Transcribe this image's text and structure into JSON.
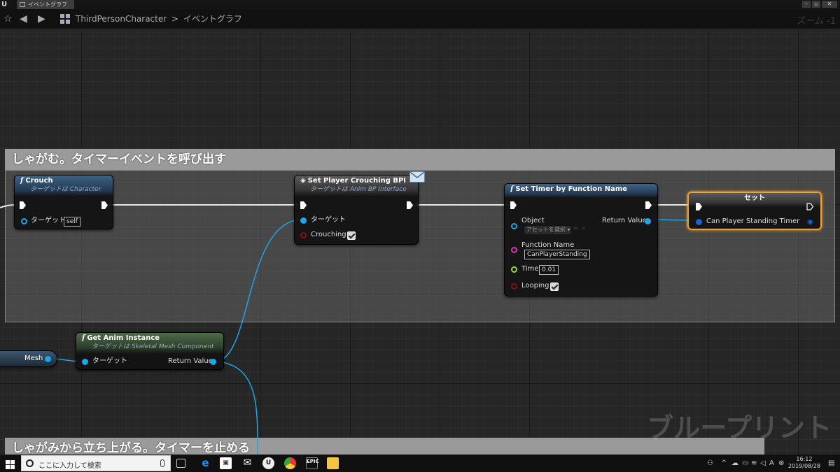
{
  "window": {
    "tab_label": "イベントグラフ"
  },
  "breadcrumb": {
    "blueprint": "ThirdPersonCharacter",
    "separator": ">",
    "graph": "イベントグラフ"
  },
  "zoom": "ズーム -1",
  "comments": {
    "top": "しゃがむ。タイマーイベントを呼び出す",
    "bottom": "しゃがみから立ち上がる。タイマーを止める"
  },
  "nodes": {
    "crouch": {
      "title": "Crouch",
      "subtitle": "ターゲットは Character",
      "target_label": "ターゲット",
      "target_value": "self"
    },
    "set_player_crouching": {
      "title": "Set Player Crouching BPI",
      "subtitle": "ターゲットは Anim BP Interface",
      "target_label": "ターゲット",
      "crouching_label": "Crouching",
      "crouching_checked": true
    },
    "set_timer": {
      "title": "Set Timer by Function Name",
      "object_label": "Object",
      "object_value": "アセットを選択",
      "return_label": "Return Value",
      "function_name_label": "Function Name",
      "function_name_value": "CanPlayerStanding",
      "time_label": "Time",
      "time_value": "0.01",
      "looping_label": "Looping",
      "looping_checked": true
    },
    "set_var": {
      "title": "セット",
      "var_label": "Can Player Standing Timer"
    },
    "get_anim_instance": {
      "title": "Get Anim Instance",
      "subtitle": "ターゲットは Skeletal Mesh Component",
      "target_label": "ターゲット",
      "return_label": "Return Value"
    },
    "mesh": {
      "label": "Mesh"
    }
  },
  "watermark": "ブループリント",
  "taskbar": {
    "search_placeholder": "ここに入力して検索",
    "time": "16:12",
    "date": "2019/08/28"
  },
  "colors": {
    "object_pin": "#1aa6e8",
    "string_pin": "#e52ac9",
    "float_pin": "#8edc3c",
    "bool_pin": "#8c0e0e",
    "variable_pin": "#1d5fd6",
    "selected_outline": "#f2a22b"
  }
}
